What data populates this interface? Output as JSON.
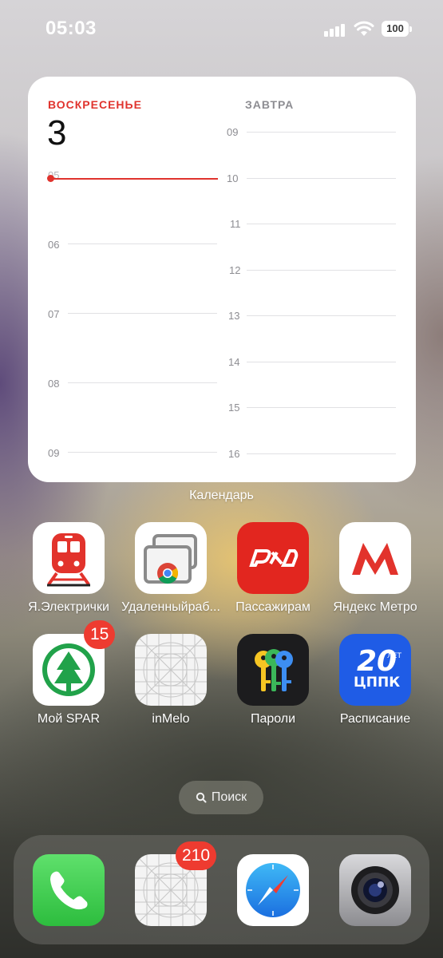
{
  "status_bar": {
    "time": "05:03",
    "battery": "100"
  },
  "widget": {
    "today_label": "ВОСКРЕСЕНЬЕ",
    "day_number": "3",
    "tomorrow_label": "ЗАВТРА",
    "today_hours": [
      "05",
      "06",
      "07",
      "08",
      "09"
    ],
    "tomorrow_hours": [
      "09",
      "10",
      "11",
      "12",
      "13",
      "14",
      "15",
      "16"
    ],
    "label": "Календарь"
  },
  "apps": [
    {
      "label": "Я.Электрички",
      "icon": "train-icon"
    },
    {
      "label": "Удаленныйраб...",
      "icon": "chrome-remote-desktop-icon"
    },
    {
      "label": "Пассажирам",
      "icon": "rzd-logo-icon"
    },
    {
      "label": "Яндекс Метро",
      "icon": "metro-logo-icon"
    },
    {
      "label": "Мой SPAR",
      "icon": "spar-logo-icon",
      "badge": "15"
    },
    {
      "label": "inMelo",
      "icon": "placeholder-app-icon"
    },
    {
      "label": "Пароли",
      "icon": "keys-icon"
    },
    {
      "label": "Расписание",
      "icon": "cppk-logo-icon",
      "icon_text_top": "20",
      "icon_text_small": "ЛЕТ",
      "icon_text_bottom": "ЦППК"
    }
  ],
  "search": {
    "label": "Поиск",
    "icon": "search-icon"
  },
  "dock": [
    {
      "icon": "phone-icon"
    },
    {
      "icon": "placeholder-app-icon",
      "badge": "210"
    },
    {
      "icon": "safari-compass-icon"
    },
    {
      "icon": "camera-lens-icon"
    }
  ]
}
